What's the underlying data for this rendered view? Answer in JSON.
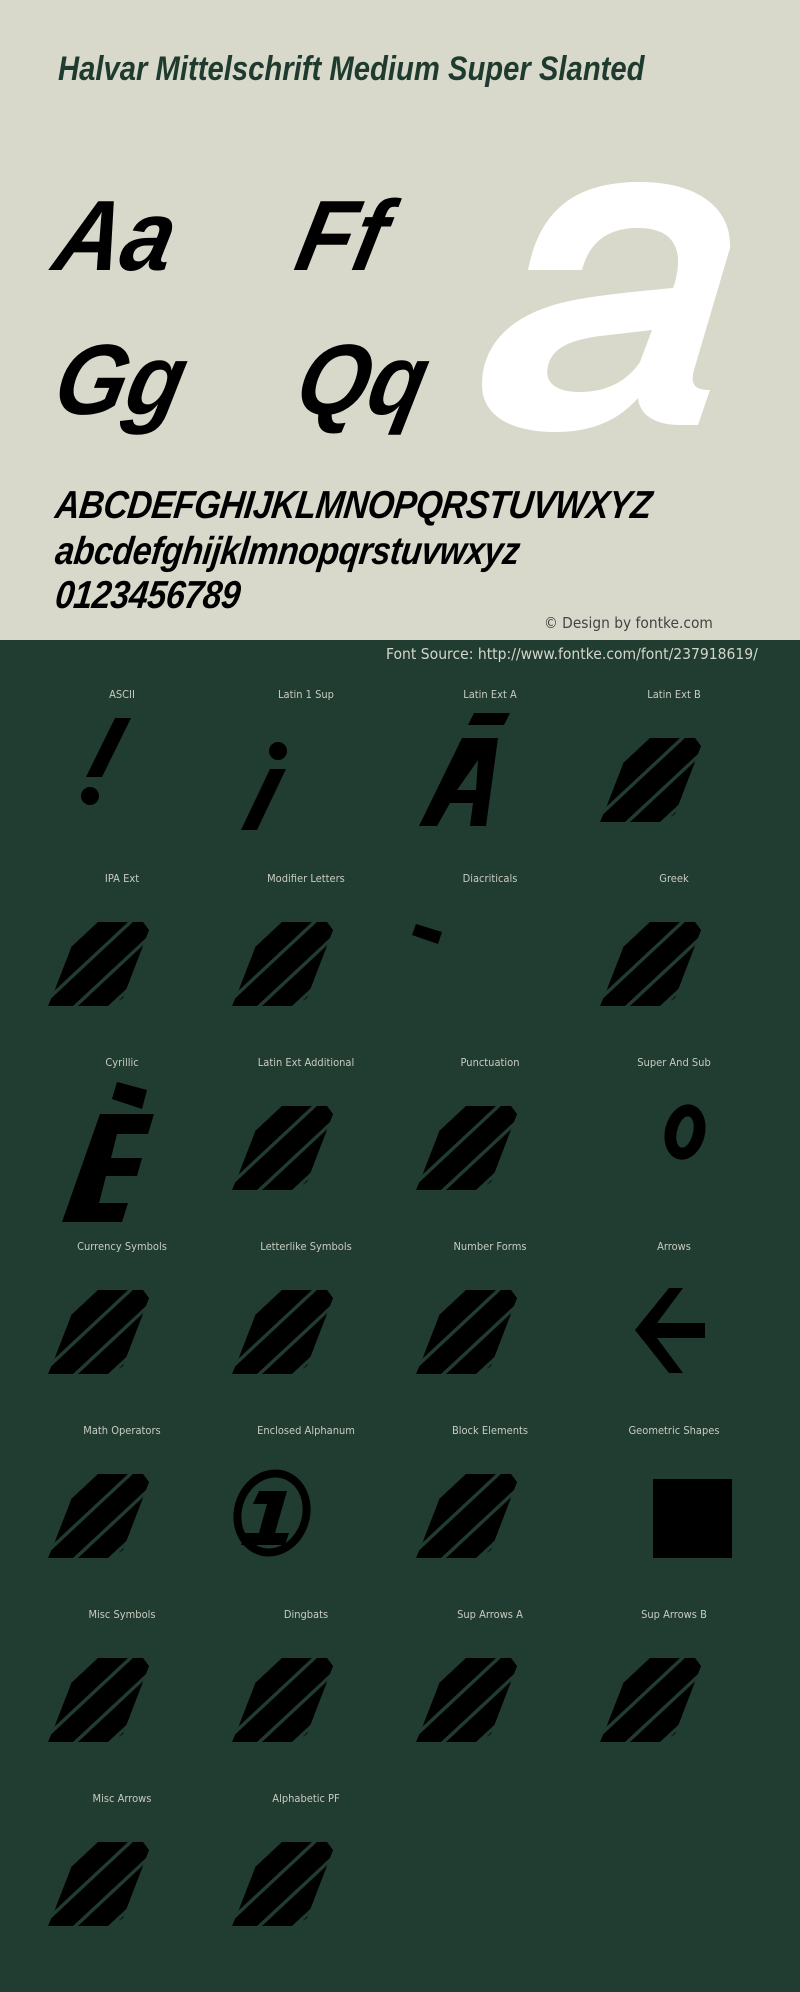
{
  "header": {
    "title": "Halvar Mittelschrift Medium Super Slanted"
  },
  "specimen": {
    "pairs": [
      "Aa",
      "Ff",
      "Gg",
      "Qq"
    ],
    "hero_glyph": "a",
    "uppercase": "ABCDEFGHIJKLMNOPQRSTUVWXYZ",
    "lowercase": "abcdefghijklmnopqrstuvwxyz",
    "digits": "0123456789"
  },
  "footer": {
    "copyright": "© Design by fontke.com",
    "source": "Font Source: http://www.fontke.com/font/237918619/"
  },
  "colors": {
    "top_background": "#d8d9cb",
    "bottom_background": "#213c30",
    "title": "#1f3b2f",
    "glyph": "#000000",
    "hero_glyph": "#ffffff"
  },
  "blocks": [
    {
      "label": "ASCII",
      "glyph": "exclamation"
    },
    {
      "label": "Latin 1 Sup",
      "glyph": "inverted-exclamation"
    },
    {
      "label": "Latin Ext A",
      "glyph": "a-macron"
    },
    {
      "label": "Latin Ext B",
      "glyph": "missing"
    },
    {
      "label": "IPA Ext",
      "glyph": "missing"
    },
    {
      "label": "Modifier Letters",
      "glyph": "missing"
    },
    {
      "label": "Diacriticals",
      "glyph": "grave-accent"
    },
    {
      "label": "Greek",
      "glyph": "missing"
    },
    {
      "label": "Cyrillic",
      "glyph": "e-grave"
    },
    {
      "label": "Latin Ext Additional",
      "glyph": "missing"
    },
    {
      "label": "Punctuation",
      "glyph": "missing"
    },
    {
      "label": "Super And Sub",
      "glyph": "superscript-zero"
    },
    {
      "label": "Currency Symbols",
      "glyph": "missing"
    },
    {
      "label": "Letterlike Symbols",
      "glyph": "missing"
    },
    {
      "label": "Number Forms",
      "glyph": "missing"
    },
    {
      "label": "Arrows",
      "glyph": "left-arrow"
    },
    {
      "label": "Math Operators",
      "glyph": "missing"
    },
    {
      "label": "Enclosed Alphanum",
      "glyph": "circled-one"
    },
    {
      "label": "Block Elements",
      "glyph": "missing"
    },
    {
      "label": "Geometric Shapes",
      "glyph": "black-square"
    },
    {
      "label": "Misc Symbols",
      "glyph": "missing"
    },
    {
      "label": "Dingbats",
      "glyph": "missing"
    },
    {
      "label": "Sup Arrows A",
      "glyph": "missing"
    },
    {
      "label": "Sup Arrows B",
      "glyph": "missing"
    },
    {
      "label": "Misc Arrows",
      "glyph": "missing"
    },
    {
      "label": "Alphabetic PF",
      "glyph": "missing"
    }
  ]
}
